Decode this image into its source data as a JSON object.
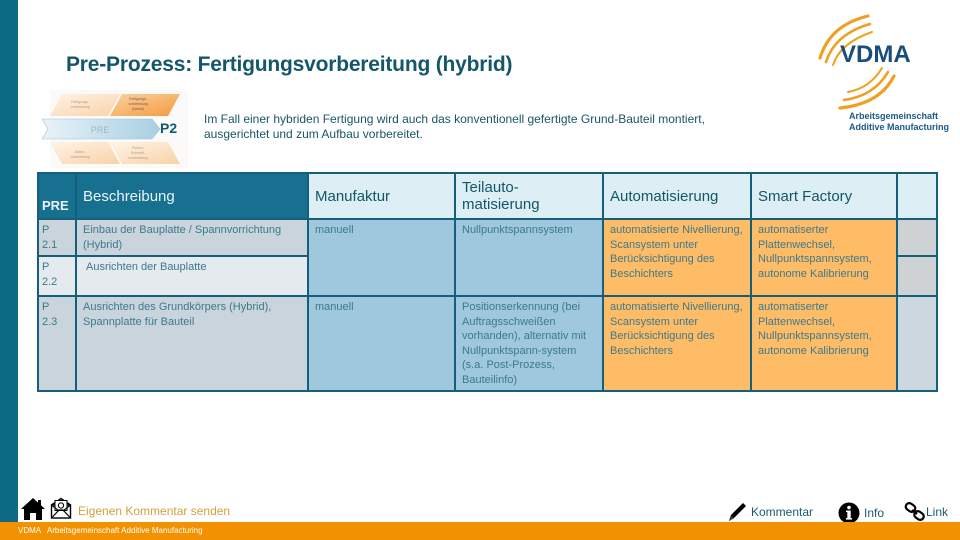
{
  "title": "Pre-Prozess: Fertigungsvorbereitung (hybrid)",
  "process_diagram": {
    "center_label": "PRE",
    "step_label": "P2",
    "segments": [
      "Fertigungs-vorbereitung",
      "Fertigungs-vorbereitung (hybrid)",
      "Daten-vorbereitung",
      "Pulver-/Rohstoff-vorbereitung"
    ]
  },
  "intro_text": "Im Fall einer hybriden Fertigung wird auch das konventionell gefertigte Grund-Bauteil montiert, ausgerichtet und zum Aufbau vorbereitet.",
  "logo": {
    "name": "VDMA",
    "subtitle_line1": "Arbeitsgemeinschaft",
    "subtitle_line2": "Additive Manufacturing"
  },
  "table": {
    "headers": {
      "pre": "PRE",
      "beschreibung": "Beschreibung",
      "manufaktur": "Manufaktur",
      "teilautomatisierung": "Teilauto-\nmatisierung",
      "automatisierung": "Automatisierung",
      "smart_factory": "Smart Factory",
      "extra": ""
    },
    "rows": [
      {
        "id": "P 2.1",
        "beschreibung": "Einbau der Bauplatte / Spannvorrichtung (Hybrid)",
        "manufaktur": "manuell",
        "teilautomatisierung": "Nullpunktspannsystem",
        "automatisierung": "automatisierte Nivellierung, Scansystem unter Berücksichtigung des Beschichters",
        "smart_factory": "automatiserter Plattenwechsel, Nullpunktspannsystem, autonome Kalibrierung"
      },
      {
        "id": "P 2.2",
        "beschreibung": "Ausrichten der Bauplatte"
      },
      {
        "id": "P 2.3",
        "beschreibung": "Ausrichten des Grundkörpers (Hybrid), Spannplatte für Bauteil",
        "manufaktur": "manuell",
        "teilautomatisierung": "Positionserkennung (bei Auftragsschweißen vorhanden), alternativ mit Nullpunktspann-system (s.a. Post-Prozess, Bauteilinfo)",
        "automatisierung": "automatisierte Nivellierung, Scansystem unter Berücksichtigung des Beschichters",
        "smart_factory": "automatiserter Plattenwechsel, Nullpunktspannsystem, autonome Kalibrierung"
      }
    ]
  },
  "footer": {
    "comment_link": "Eigenen Kommentar senden",
    "org_text": "VDMA   Arbeitsgemeinschaft Additive Manufacturing",
    "actions": {
      "kommentar": "Kommentar",
      "info": "Info",
      "link": "Link"
    }
  },
  "colors": {
    "sidebar": "#0d6a85",
    "accent_orange": "#f39200",
    "cell_blue": "#9fc8de",
    "cell_orange": "#ffbc66",
    "header_dark": "#17708f"
  }
}
